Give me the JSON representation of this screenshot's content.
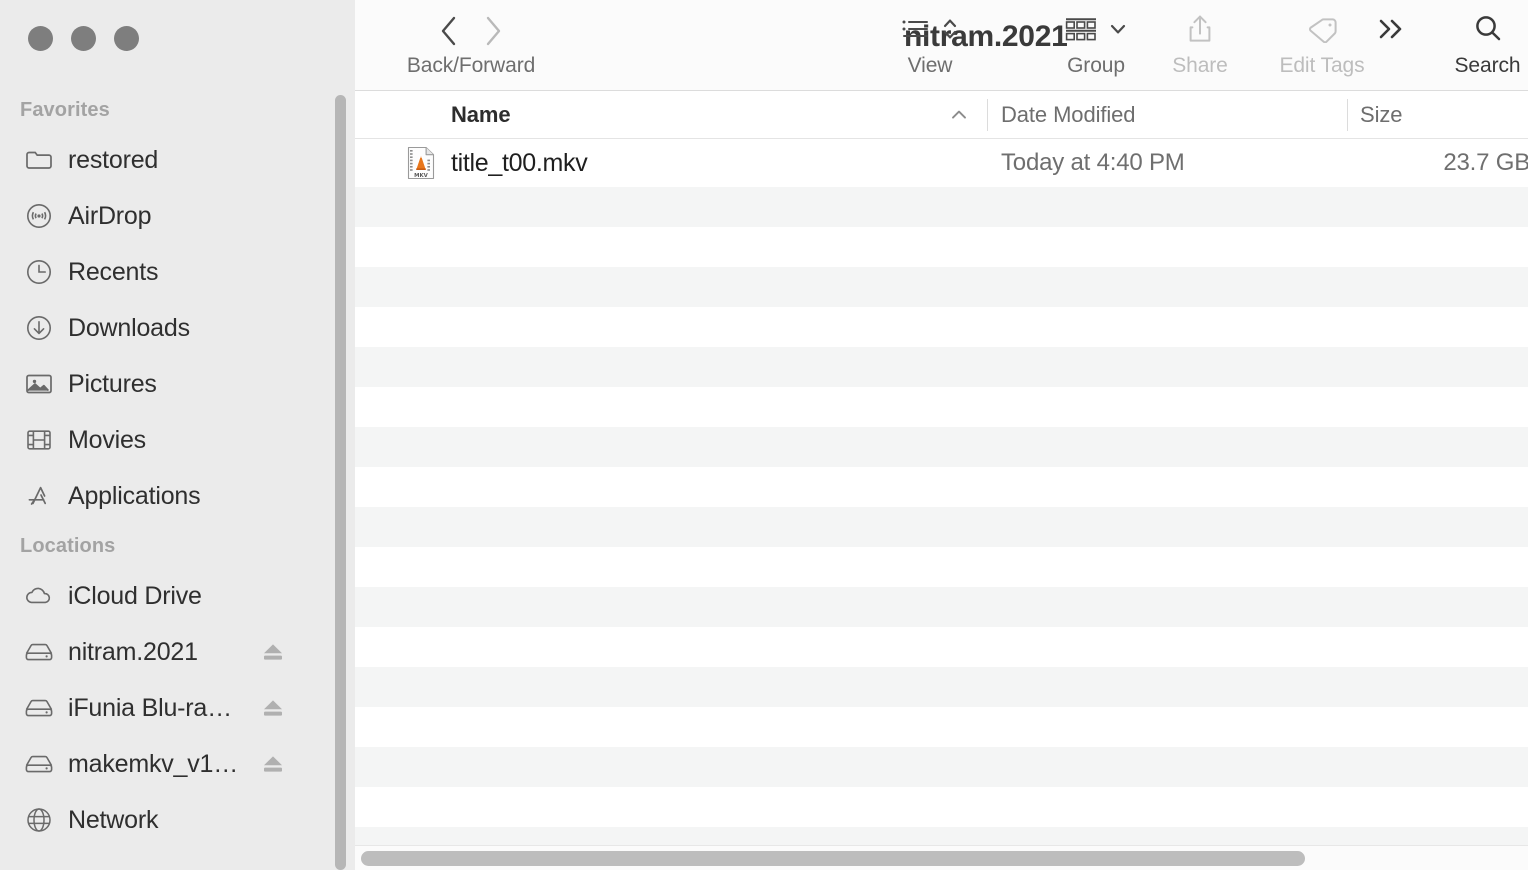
{
  "window": {
    "title": "nitram.2021",
    "traffic_lights": [
      {
        "name": "close",
        "color": "#7e7e7e"
      },
      {
        "name": "minimize",
        "color": "#7e7e7e"
      },
      {
        "name": "maximize",
        "color": "#7e7e7e"
      }
    ]
  },
  "sidebar": {
    "sections": [
      {
        "header": "Favorites",
        "items": [
          {
            "label": "restored",
            "icon": "folder-icon",
            "eject": false
          },
          {
            "label": "AirDrop",
            "icon": "airdrop-icon",
            "eject": false
          },
          {
            "label": "Recents",
            "icon": "clock-icon",
            "eject": false
          },
          {
            "label": "Downloads",
            "icon": "download-icon",
            "eject": false
          },
          {
            "label": "Pictures",
            "icon": "pictures-icon",
            "eject": false
          },
          {
            "label": "Movies",
            "icon": "film-icon",
            "eject": false
          },
          {
            "label": "Applications",
            "icon": "appstore-icon",
            "eject": false
          }
        ]
      },
      {
        "header": "Locations",
        "items": [
          {
            "label": "iCloud Drive",
            "icon": "cloud-icon",
            "eject": false
          },
          {
            "label": "nitram.2021",
            "icon": "disk-icon",
            "eject": true
          },
          {
            "label": "iFunia Blu-ra…",
            "icon": "disk-icon",
            "eject": true
          },
          {
            "label": "makemkv_v1…",
            "icon": "disk-icon",
            "eject": true
          },
          {
            "label": "Network",
            "icon": "globe-icon",
            "eject": false
          }
        ]
      }
    ]
  },
  "toolbar": {
    "back_forward_label": "Back/Forward",
    "back_icon": "chevron-left-icon",
    "forward_icon": "chevron-right-icon",
    "view_label": "View",
    "view_icon": "list-view-icon",
    "view_chevron_icon": "chevron-up-down-icon",
    "group_label": "Group",
    "group_icon": "grid-group-icon",
    "group_chevron_icon": "chevron-down-icon",
    "share_label": "Share",
    "share_icon": "share-icon",
    "edit_tags_label": "Edit Tags",
    "edit_tags_icon": "tag-icon",
    "more_icon": "chevron-double-right-icon",
    "search_label": "Search",
    "search_icon": "search-icon"
  },
  "columns": {
    "name": "Name",
    "date_modified": "Date Modified",
    "size": "Size",
    "sort_arrow_icon": "chevron-up-icon"
  },
  "files": [
    {
      "name": "title_t00.mkv",
      "date_modified": "Today at 4:40 PM",
      "size": "23.7 GB",
      "icon": "mkv-file-icon"
    }
  ],
  "colors": {
    "sidebar_bg": "#ebebeb",
    "toolbar_bg": "#fbfbfb",
    "content_bg": "#ffffff",
    "row_alt_bg": "#f4f5f5",
    "scrollbar_thumb": "#bdbdbd",
    "vlc_orange": "#e8761b"
  }
}
